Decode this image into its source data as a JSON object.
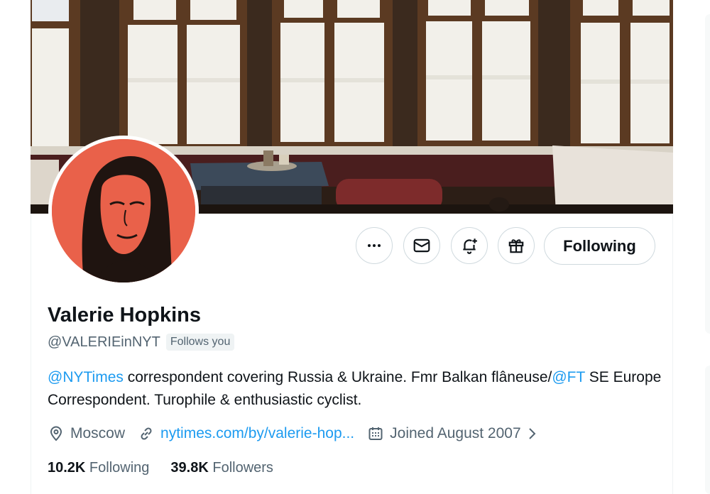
{
  "profile": {
    "name": "Valerie Hopkins",
    "handle": "@VALERIEinNYT",
    "follows_you": "Follows you",
    "bio": {
      "mention1": "@NYTimes",
      "text1": " correspondent covering Russia & Ukraine. Fmr Balkan flâneuse/",
      "mention2": "@FT",
      "text2": " SE Europe Correspondent. Turophile & enthusiastic cyclist."
    },
    "location": "Moscow",
    "website": "nytimes.com/by/valerie-hop...",
    "joined": "Joined August 2007",
    "following_count": "10.2K",
    "following_label": " Following",
    "followers_count": "39.8K",
    "followers_label": " Followers"
  },
  "actions": {
    "more": "more-icon",
    "message": "envelope-icon",
    "notify": "bell-plus-icon",
    "gift": "gift-icon",
    "follow_label": "Following"
  },
  "colors": {
    "link": "#1d9bf0",
    "secondary_text": "#536471",
    "avatar_bg": "#e9614a"
  }
}
